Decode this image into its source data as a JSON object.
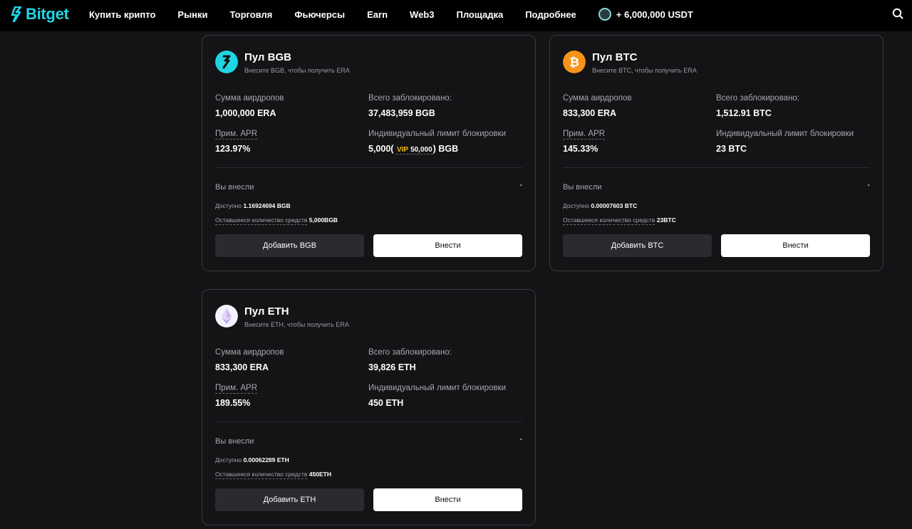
{
  "header": {
    "logo_text": "Bitget",
    "nav": [
      "Купить крипто",
      "Рынки",
      "Торговля",
      "Фьючерсы",
      "Earn",
      "Web3",
      "Площадка",
      "Подробнее"
    ],
    "promo_text": "+ 6,000,000 USDT"
  },
  "labels": {
    "airdrop_total": "Сумма аирдропов",
    "total_locked": "Всего заблокировано:",
    "est_apr": "Прим. APR",
    "individual_limit": "Индивидуальный лимит блокировки",
    "you_deposited": "Вы внесли",
    "available": "Доступно",
    "remaining": "Оставшееся количество средств",
    "deposit_button": "Внести"
  },
  "pools": {
    "bgb": {
      "title": "Пул BGB",
      "subtitle": "Внесите BGB, чтобы получить ERA",
      "airdrop_value": "1,000,000 ERA",
      "locked_value": "37,483,959 BGB",
      "apr_value": "123.97%",
      "limit_value": "5,000",
      "limit_paren_open": "(",
      "limit_vip_label": "VIP",
      "limit_vip_value": "50,000",
      "limit_paren_close": ")",
      "limit_unit": "BGB",
      "deposited_value": "-",
      "available_value": "1.16924694 BGB",
      "remaining_value": "5,000BGB",
      "add_button": "Добавить BGB",
      "icon_color": "#1ed5e4"
    },
    "btc": {
      "title": "Пул BTC",
      "subtitle": "Внесите BTC, чтобы получить ERA",
      "airdrop_value": "833,300 ERA",
      "locked_value": "1,512.91 BTC",
      "apr_value": "145.33%",
      "limit_value": "23 BTC",
      "deposited_value": "-",
      "available_value": "0.00007603 BTC",
      "remaining_value": "23BTC",
      "add_button": "Добавить BTC",
      "icon_color": "#f7931a"
    },
    "eth": {
      "title": "Пул ETH",
      "subtitle": "Внесите ETH, чтобы получить ERA",
      "airdrop_value": "833,300 ERA",
      "locked_value": "39,826 ETH",
      "apr_value": "189.55%",
      "limit_value": "450 ETH",
      "deposited_value": "-",
      "available_value": "0.00062289 ETH",
      "remaining_value": "450ETH",
      "add_button": "Добавить ETH",
      "icon_color": "#ffffff"
    }
  }
}
